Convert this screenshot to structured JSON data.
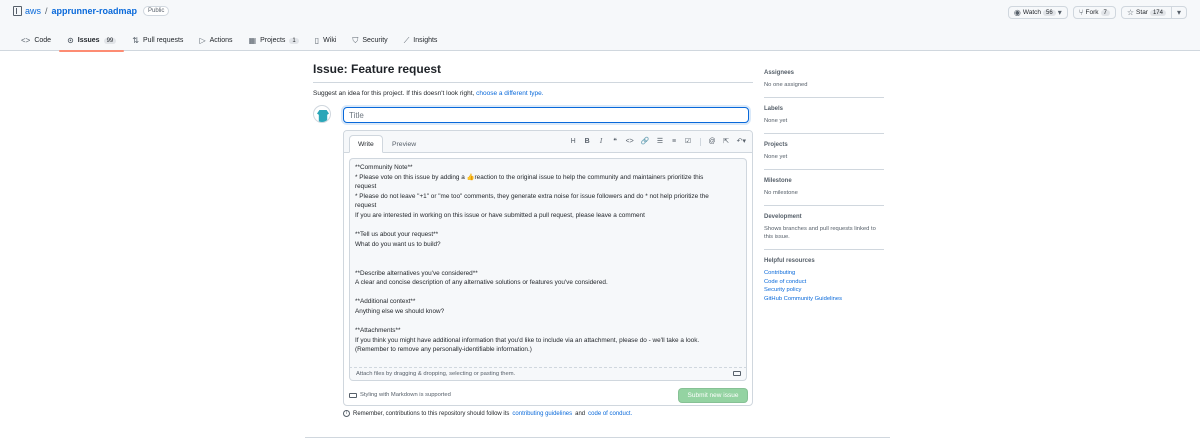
{
  "repo": {
    "owner": "aws",
    "separator": "/",
    "name": "apprunner-roadmap",
    "visibility": "Public"
  },
  "actions": {
    "watch": {
      "label": "Watch",
      "count": "56"
    },
    "fork": {
      "label": "Fork",
      "count": "7"
    },
    "star": {
      "label": "Star",
      "count": "174"
    }
  },
  "tabs": [
    {
      "label": "Code",
      "icon": "code-icon"
    },
    {
      "label": "Issues",
      "icon": "issue-opened-icon",
      "count": "99",
      "active": true
    },
    {
      "label": "Pull requests",
      "icon": "git-pull-request-icon"
    },
    {
      "label": "Actions",
      "icon": "play-icon"
    },
    {
      "label": "Projects",
      "icon": "table-icon",
      "count": "1"
    },
    {
      "label": "Wiki",
      "icon": "book-icon"
    },
    {
      "label": "Security",
      "icon": "shield-icon"
    },
    {
      "label": "Insights",
      "icon": "graph-icon"
    }
  ],
  "issue": {
    "page_title": "Issue: Feature request",
    "subtitle_prefix": "Suggest an idea for this project. If this doesn't look right,",
    "subtitle_link": "choose a different type."
  },
  "composer": {
    "title_placeholder": "Title",
    "write_tab": "Write",
    "preview_tab": "Preview",
    "toolbar_icons": [
      "heading-icon",
      "bold-icon",
      "italic-icon",
      "quote-icon",
      "code-icon",
      "link-icon",
      "unordered-list-icon",
      "ordered-list-icon",
      "tasklist-icon",
      "mention-icon",
      "cross-reference-icon",
      "reply-icon"
    ],
    "body_lines": [
      "**Community Note**",
      "* Please vote on this issue by adding a 👍reaction to the original issue to help the community and maintainers prioritize this",
      "request",
      "* Please do not leave \"+1\" or \"me too\" comments, they generate extra noise for issue followers and do * not help prioritize the",
      "request",
      "If you are interested in working on this issue or have submitted a pull request, please leave a comment",
      "",
      "**Tell us about your request**",
      "What do you want us to build?",
      "",
      "",
      "**Describe alternatives you've considered**",
      "A clear and concise description of any alternative solutions or features you've considered.",
      "",
      "**Additional context**",
      "Anything else we should know?",
      "",
      "**Attachments**",
      "If you think you might have additional information that you'd like to include via an attachment, please do - we'll take a look.",
      "(Remember to remove any personally-identifiable information.)"
    ],
    "attach_hint": "Attach files by dragging & dropping, selecting or pasting them.",
    "markdown_note": "Styling with Markdown is supported",
    "submit_label": "Submit new issue"
  },
  "remember": {
    "prefix": "Remember, contributions to this repository should follow its",
    "guidelines_link": "contributing guidelines",
    "and": "and",
    "conduct_link": "code of conduct."
  },
  "sidebar": {
    "assignees": {
      "heading": "Assignees",
      "value": "No one assigned"
    },
    "labels": {
      "heading": "Labels",
      "value": "None yet"
    },
    "projects": {
      "heading": "Projects",
      "value": "None yet"
    },
    "milestone": {
      "heading": "Milestone",
      "value": "No milestone"
    },
    "development": {
      "heading": "Development",
      "value": "Shows branches and pull requests linked to this issue."
    },
    "helpful": {
      "heading": "Helpful resources",
      "links": [
        "Contributing",
        "Code of conduct",
        "Security policy",
        "GitHub Community Guidelines"
      ]
    }
  },
  "colors": {
    "link": "#0969da",
    "active_tab_underline": "#fd8c73",
    "submit_disabled": "#94d3a2",
    "focus_border": "#0969da"
  }
}
